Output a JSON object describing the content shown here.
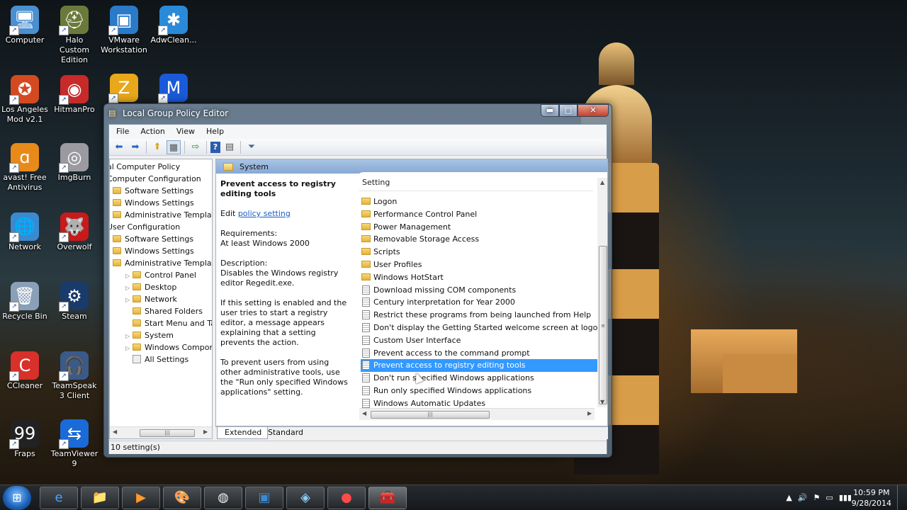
{
  "desktop": {
    "icons": [
      {
        "label": "Computer",
        "glyph": "🖥"
      },
      {
        "label": "Halo Custom Edition",
        "glyph": "⛑"
      },
      {
        "label": "VMware Workstation",
        "glyph": "▣"
      },
      {
        "label": "AdwClean...",
        "glyph": "✱"
      },
      {
        "label": "Los Angeles Mod v2.1",
        "glyph": "✪"
      },
      {
        "label": "HitmanPro",
        "glyph": "◉"
      },
      {
        "label": "avast! Free Antivirus",
        "glyph": "ɑ"
      },
      {
        "label": "ImgBurn",
        "glyph": "◎"
      },
      {
        "label": "Network",
        "glyph": "🌐"
      },
      {
        "label": "Overwolf",
        "glyph": "🐺"
      },
      {
        "label": "Recycle Bin",
        "glyph": "🗑"
      },
      {
        "label": "Steam",
        "glyph": "⚙"
      },
      {
        "label": "CCleaner",
        "glyph": "C"
      },
      {
        "label": "TeamSpeak 3 Client",
        "glyph": "🎧"
      },
      {
        "label": "Fraps",
        "glyph": "99"
      },
      {
        "label": "TeamViewer 9",
        "glyph": "⇆"
      }
    ],
    "partial_icons": [
      {
        "glyph": "Z"
      },
      {
        "glyph": "M"
      }
    ]
  },
  "window": {
    "title": "Local Group Policy Editor",
    "controls": {
      "minimize": "▬",
      "maximize": "□",
      "close": "✕"
    },
    "menu": [
      "File",
      "Action",
      "View",
      "Help"
    ],
    "toolbar_icons": [
      "back-arrow-icon",
      "forward-arrow-icon",
      "up-folder-icon",
      "show-hide-tree-icon",
      "export-list-icon",
      "help-icon",
      "properties-icon",
      "filter-icon"
    ],
    "tree": [
      {
        "label": "al Computer Policy",
        "indent": 0,
        "folder": false,
        "expand": ""
      },
      {
        "label": "Computer Configuration",
        "indent": 0,
        "folder": false,
        "expand": ""
      },
      {
        "label": "Software Settings",
        "indent": 1,
        "folder": true,
        "expand": ""
      },
      {
        "label": "Windows Settings",
        "indent": 1,
        "folder": true,
        "expand": ""
      },
      {
        "label": "Administrative Templates",
        "indent": 1,
        "folder": true,
        "expand": ""
      },
      {
        "label": "User Configuration",
        "indent": 0,
        "folder": false,
        "expand": ""
      },
      {
        "label": "Software Settings",
        "indent": 1,
        "folder": true,
        "expand": ""
      },
      {
        "label": "Windows Settings",
        "indent": 1,
        "folder": true,
        "expand": ""
      },
      {
        "label": "Administrative Templates",
        "indent": 1,
        "folder": true,
        "expand": ""
      },
      {
        "label": "Control Panel",
        "indent": 2,
        "folder": true,
        "expand": "▷"
      },
      {
        "label": "Desktop",
        "indent": 2,
        "folder": true,
        "expand": "▷"
      },
      {
        "label": "Network",
        "indent": 2,
        "folder": true,
        "expand": "▷"
      },
      {
        "label": "Shared Folders",
        "indent": 2,
        "folder": true,
        "expand": ""
      },
      {
        "label": "Start Menu and Taskb",
        "indent": 2,
        "folder": true,
        "expand": ""
      },
      {
        "label": "System",
        "indent": 2,
        "folder": true,
        "expand": "▷"
      },
      {
        "label": "Windows Component",
        "indent": 2,
        "folder": true,
        "expand": "▷"
      },
      {
        "label": "All Settings",
        "indent": 2,
        "folder": false,
        "expand": "",
        "settings_icon": true
      }
    ],
    "right_header": "System",
    "description": {
      "title": "Prevent access to registry editing tools",
      "edit_prefix": "Edit",
      "edit_link": "policy setting",
      "requirements_label": "Requirements:",
      "requirements_value": "At least Windows 2000",
      "description_label": "Description:",
      "description_text": "Disables the Windows registry editor Regedit.exe.",
      "para2": "If this setting is enabled and the user tries to start a registry editor, a message appears explaining that a setting prevents the action.",
      "para3": "To prevent users from using other administrative tools, use the \"Run only specified Windows applications\" setting."
    },
    "list": {
      "column": "Setting",
      "rows": [
        {
          "label": "Logon",
          "kind": "folder"
        },
        {
          "label": "Performance Control Panel",
          "kind": "folder"
        },
        {
          "label": "Power Management",
          "kind": "folder"
        },
        {
          "label": "Removable Storage Access",
          "kind": "folder"
        },
        {
          "label": "Scripts",
          "kind": "folder"
        },
        {
          "label": "User Profiles",
          "kind": "folder"
        },
        {
          "label": "Windows HotStart",
          "kind": "folder"
        },
        {
          "label": "Download missing COM components",
          "kind": "policy"
        },
        {
          "label": "Century interpretation for Year 2000",
          "kind": "policy"
        },
        {
          "label": "Restrict these programs from being launched from Help",
          "kind": "policy"
        },
        {
          "label": "Don't display the Getting Started welcome screen at logon",
          "kind": "policy"
        },
        {
          "label": "Custom User Interface",
          "kind": "policy"
        },
        {
          "label": "Prevent access to the command prompt",
          "kind": "policy"
        },
        {
          "label": "Prevent access to registry editing tools",
          "kind": "policy",
          "selected": true
        },
        {
          "label": "Don't run specified Windows applications",
          "kind": "policy"
        },
        {
          "label": "Run only specified Windows applications",
          "kind": "policy"
        },
        {
          "label": "Windows Automatic Updates",
          "kind": "policy"
        }
      ]
    },
    "tabs": [
      "Extended",
      "Standard"
    ],
    "active_tab": "Extended",
    "status": "10 setting(s)"
  },
  "taskbar": {
    "start_glyph": "⊞",
    "buttons": [
      {
        "name": "taskbar-internet-explorer",
        "glyph": "e"
      },
      {
        "name": "taskbar-file-explorer",
        "glyph": "📁"
      },
      {
        "name": "taskbar-media-player",
        "glyph": "▶"
      },
      {
        "name": "taskbar-paint",
        "glyph": "🎨"
      },
      {
        "name": "taskbar-chrome",
        "glyph": "◍"
      },
      {
        "name": "taskbar-vmware",
        "glyph": "▣"
      },
      {
        "name": "taskbar-app",
        "glyph": "◈"
      },
      {
        "name": "taskbar-recorder",
        "glyph": "●"
      },
      {
        "name": "taskbar-group-policy",
        "glyph": "🧰",
        "active": true
      }
    ],
    "tray_icons": [
      "▲",
      "🔊",
      "⚑",
      "▭",
      "▮▮▮"
    ],
    "time": "10:59 PM",
    "date": "9/28/2014"
  }
}
